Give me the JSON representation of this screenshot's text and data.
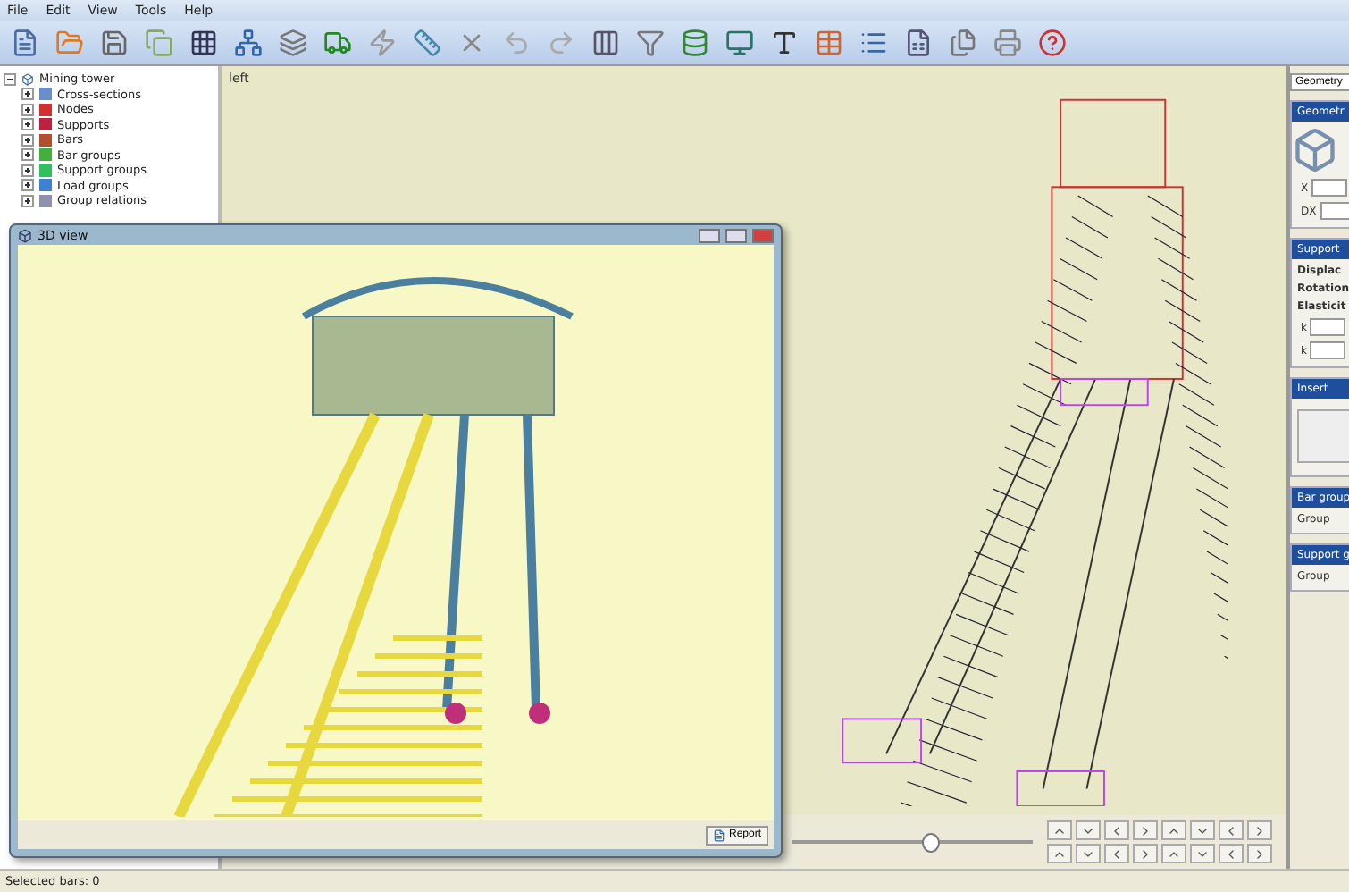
{
  "menu": [
    "File",
    "Edit",
    "View",
    "Tools",
    "Help"
  ],
  "tree": {
    "label": "Mining tower",
    "expanded": true,
    "children": [
      {
        "label": "Cross-sections",
        "expanded": false,
        "color": "#6a8fc8"
      },
      {
        "label": "Nodes",
        "expanded": false,
        "color": "#d03030"
      },
      {
        "label": "Supports",
        "expanded": false,
        "color": "#c02040"
      },
      {
        "label": "Bars",
        "expanded": false,
        "color": "#b05030"
      },
      {
        "label": "Bar groups",
        "expanded": false,
        "color": "#40b040"
      },
      {
        "label": "Support groups",
        "expanded": false,
        "color": "#30c060"
      },
      {
        "label": "Load groups",
        "expanded": false,
        "color": "#4080d0"
      },
      {
        "label": "Group relations",
        "expanded": false,
        "color": "#9090b0"
      }
    ]
  },
  "view": {
    "label": "left",
    "slider": {
      "level": 0.58
    }
  },
  "window3d": {
    "title": "3D view",
    "button": "Report"
  },
  "right": {
    "tab": "Geometry",
    "sections": [
      {
        "kind": "geometry",
        "title": "Geometr",
        "fields": [
          "X",
          "DX"
        ]
      },
      {
        "kind": "support",
        "title": "Support",
        "labels": [
          "Displac",
          "Rotation",
          "Elasticit"
        ],
        "fields": [
          "k",
          "k"
        ]
      },
      {
        "kind": "insert",
        "title": "Insert"
      },
      {
        "kind": "group",
        "title": "Bar group",
        "label": "Group"
      },
      {
        "kind": "group",
        "title": "Support g",
        "label": "Group"
      }
    ]
  },
  "status": "Selected bars: 0"
}
